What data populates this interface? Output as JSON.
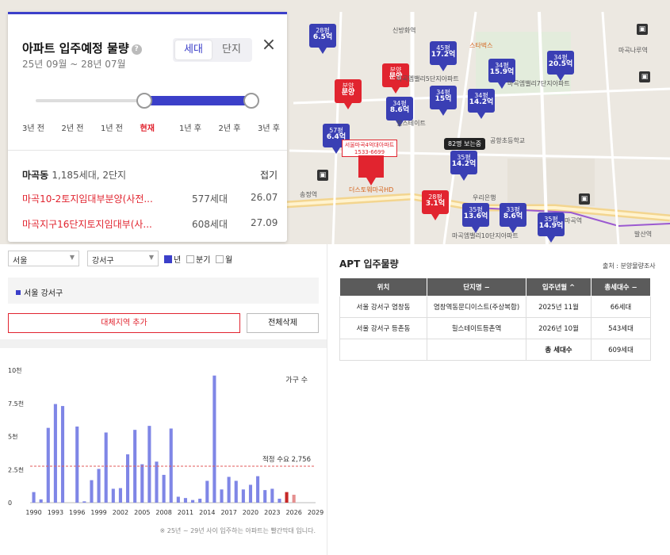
{
  "card": {
    "title": "아파트 입주예정 물량",
    "help_icon": "?",
    "period": "25년 09월 ~ 28년 07월",
    "toggle": {
      "selected": "세대",
      "other": "단지"
    },
    "close_icon": "×",
    "slider": {
      "labels": [
        "3년 전",
        "2년 전",
        "1년 전",
        "현재",
        "1년 후",
        "2년 후",
        "3년 후"
      ],
      "current_label": "현재",
      "range_start_index": 3,
      "range_end_index": 6
    },
    "region": {
      "name": "마곡동",
      "summary": "1,185세대, 2단지",
      "fold_label": "접기"
    },
    "complexes": [
      {
        "name": "마곡10-2토지임대부분양(사전...",
        "units": "577세대",
        "date": "26.07"
      },
      {
        "name": "마곡지구16단지토지임대부(사...",
        "units": "608세대",
        "date": "27.09"
      }
    ]
  },
  "map": {
    "pins": [
      {
        "top": "28평",
        "value": "6.5억",
        "color": "blue"
      },
      {
        "top": "45평",
        "value": "17.2억",
        "color": "blue"
      },
      {
        "top": "34평",
        "value": "15.9억",
        "color": "blue"
      },
      {
        "top": "34평",
        "value": "20.5억",
        "color": "blue"
      },
      {
        "top": "분양",
        "value": "분양",
        "color": "red"
      },
      {
        "top": "분양",
        "value": "분양",
        "color": "red"
      },
      {
        "top": "34평",
        "value": "8.6억",
        "color": "blue"
      },
      {
        "top": "34평",
        "value": "15억",
        "color": "blue"
      },
      {
        "top": "34평",
        "value": "14.2억",
        "color": "blue"
      },
      {
        "top": "57평",
        "value": "6.4억",
        "color": "blue"
      },
      {
        "top": "35평",
        "value": "14.2억",
        "color": "blue"
      },
      {
        "top": "28평",
        "value": "3.1억",
        "color": "red"
      },
      {
        "top": "35평",
        "value": "13.6억",
        "color": "blue"
      },
      {
        "top": "33평",
        "value": "8.6억",
        "color": "blue"
      },
      {
        "top": "35평",
        "value": "14.9억",
        "color": "blue"
      }
    ],
    "labels": [
      "신방화역",
      "송정역",
      "마곡역",
      "마곡나루역",
      "발산역",
      "공항초등학교",
      "마곡엠밸리10단지아파트",
      "마곡엠밸리5단지아파트",
      "마곡엠밸리7단지아파트",
      "힐스테이트",
      "우리은행",
      "스타벅스"
    ],
    "chip": "82명 보는중",
    "callout": {
      "title": "서울마곡4억대아파트",
      "phone": "1533-6699",
      "bottom": "더스토웨마곡HD"
    }
  },
  "filters": {
    "city": "서울",
    "district": "강서구",
    "period_options": [
      {
        "label": "년",
        "checked": true
      },
      {
        "label": "분기",
        "checked": false
      },
      {
        "label": "월",
        "checked": false
      }
    ],
    "area_tag": "서울 강서구",
    "add_button": "대체지역 추가",
    "delete_button": "전체삭제"
  },
  "chart_data": {
    "type": "bar",
    "series_name": "가구 수",
    "x": [
      1990,
      1991,
      1992,
      1993,
      1994,
      1995,
      1996,
      1997,
      1998,
      1999,
      2000,
      2001,
      2002,
      2003,
      2004,
      2005,
      2006,
      2007,
      2008,
      2009,
      2010,
      2011,
      2012,
      2013,
      2014,
      2015,
      2016,
      2017,
      2018,
      2019,
      2020,
      2021,
      2022,
      2023,
      2024,
      2025,
      2026
    ],
    "values": [
      800,
      250,
      5650,
      7450,
      7300,
      0,
      5750,
      100,
      1700,
      2550,
      5300,
      1050,
      1100,
      3650,
      5500,
      2900,
      5800,
      3100,
      2100,
      5600,
      450,
      350,
      200,
      300,
      1650,
      9600,
      1000,
      1950,
      1650,
      1000,
      1350,
      2000,
      950,
      1050,
      300,
      800,
      600
    ],
    "highlight_x": [
      2025,
      2026
    ],
    "bar_color": "#7f86e6",
    "highlight_color": "#c62828",
    "reference_line": {
      "label": "적정 수요 2,756",
      "value": 2756,
      "color": "#e25a5a"
    },
    "ylim": [
      0,
      10000
    ],
    "y_ticks": [
      0,
      2500,
      5000,
      7500,
      10000
    ],
    "y_tick_labels": [
      "0",
      "2.5천",
      "5천",
      "7.5천",
      "10천"
    ],
    "x_tick_labels": [
      "1990",
      "1993",
      "1996",
      "1999",
      "2002",
      "2005",
      "2008",
      "2011",
      "2014",
      "2017",
      "2020",
      "2023",
      "2026",
      "2029"
    ],
    "x_ticks": [
      1990,
      1993,
      1996,
      1999,
      2002,
      2005,
      2008,
      2011,
      2014,
      2017,
      2020,
      2023,
      2026,
      2029
    ],
    "xlim": [
      1989.5,
      2029
    ],
    "footnote": "※ 25년 ~ 29년 사이 입주하는 아파트는 빨간막대 입니다."
  },
  "apt_table": {
    "title": "APT 입주물량",
    "source": "출처 : 분양물량조사",
    "headers": [
      "위치",
      "단지명 −",
      "입주년월 ^",
      "총세대수 −"
    ],
    "rows": [
      [
        "서울 강서구 염창동",
        "염창역동문디이스트(주상복합)",
        "2025년 11월",
        "66세대"
      ],
      [
        "서울 강서구 등촌동",
        "힐스테이트등촌역",
        "2026년 10월",
        "543세대"
      ]
    ],
    "total_label": "총 세대수",
    "total_value": "609세대"
  }
}
